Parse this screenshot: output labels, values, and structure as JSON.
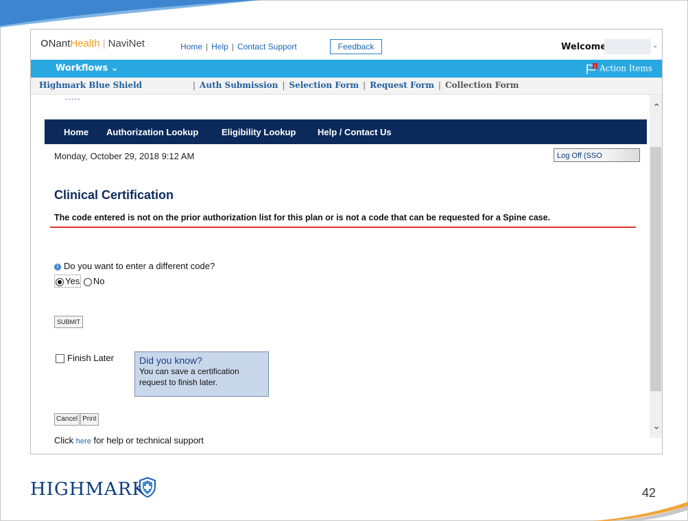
{
  "header": {
    "logo": {
      "brand": "Nant",
      "brand_accent": "Health",
      "product": "NaviNet"
    },
    "links": [
      "Home",
      "Help",
      "Contact Support"
    ],
    "feedback_label": "Feedback",
    "welcome_label": "Welcome,"
  },
  "bluebar": {
    "workflows_label": "Workflows",
    "action_items_label": "Action Items"
  },
  "subnav": {
    "plan_name": "Highmark Blue Shield",
    "links": [
      "Auth Submission",
      "Selection Form",
      "Request Form",
      "Collection Form"
    ]
  },
  "frame": {
    "nav": [
      "Home",
      "Authorization Lookup",
      "Eligibility Lookup",
      "Help / Contact Us"
    ],
    "date_text": "Monday, October 29, 2018 9:12 AM",
    "logoff_label": "Log Off (SSO",
    "title": "Clinical Certification",
    "error_message": "The code entered is not on the prior authorization list for this plan or is not a code that can be requested for a Spine case.",
    "question": "Do you want to enter a different code?",
    "radio_yes": "Yes",
    "radio_no": "No",
    "submit_label": "SUBMIT",
    "finish_later_label": "Finish Later",
    "tip": {
      "title": "Did you know?",
      "line1": "You can save a certification",
      "line2": "request to finish later."
    },
    "cancel_label": "Cancel",
    "print_label": "Print",
    "help_prefix": "Click",
    "help_link": "here",
    "help_suffix": "for help or technical support"
  },
  "footer": {
    "logo_text": "HIGHMARK.",
    "page_number": "42"
  },
  "colors": {
    "accent_blue": "#29a7e1",
    "dark_navy": "#0b2a5b",
    "error_underline": "#e0312b",
    "tip_background": "#c9d7ea"
  }
}
